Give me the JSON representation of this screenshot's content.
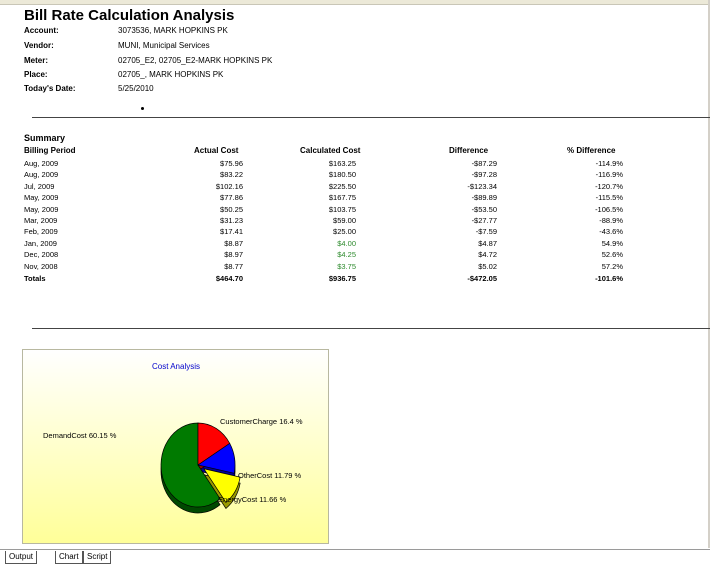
{
  "report": {
    "title": "Bill Rate Calculation Analysis",
    "header": [
      {
        "label": "Account:",
        "value": "3073536, MARK HOPKINS PK"
      },
      {
        "label": "Vendor:",
        "value": "MUNI, Municipal Services"
      },
      {
        "label": "Meter:",
        "value": "02705_E2, 02705_E2-MARK HOPKINS PK"
      },
      {
        "label": "Place:",
        "value": "02705_, MARK HOPKINS PK"
      },
      {
        "label": "Today's Date:",
        "value": "5/25/2010"
      }
    ]
  },
  "summary": {
    "title": "Summary",
    "columns": [
      "Billing Period",
      "Actual Cost",
      "Calculated Cost",
      "Difference",
      "% Difference"
    ],
    "rows": [
      [
        "Aug, 2009",
        "$75.96",
        "$163.25",
        "-$87.29",
        "-114.9%"
      ],
      [
        "Aug, 2009",
        "$83.22",
        "$180.50",
        "-$97.28",
        "-116.9%"
      ],
      [
        "Jul, 2009",
        "$102.16",
        "$225.50",
        "-$123.34",
        "-120.7%"
      ],
      [
        "May, 2009",
        "$77.86",
        "$167.75",
        "-$89.89",
        "-115.5%"
      ],
      [
        "May, 2009",
        "$50.25",
        "$103.75",
        "-$53.50",
        "-106.5%"
      ],
      [
        "Mar, 2009",
        "$31.23",
        "$59.00",
        "-$27.77",
        "-88.9%"
      ],
      [
        "Feb, 2009",
        "$17.41",
        "$25.00",
        "-$7.59",
        "-43.6%"
      ],
      [
        "Jan, 2009",
        "$8.87",
        "$4.00",
        "$4.87",
        "54.9%"
      ],
      [
        "Dec, 2008",
        "$8.97",
        "$4.25",
        "$4.72",
        "52.6%"
      ],
      [
        "Nov, 2008",
        "$8.77",
        "$3.75",
        "$5.02",
        "57.2%"
      ]
    ],
    "green_calculated_rows": [
      7,
      8,
      9
    ],
    "totals": [
      "Totals",
      "$464.70",
      "$936.75",
      "-$472.05",
      "-101.6%"
    ]
  },
  "chart_data": {
    "type": "pie",
    "title": "Cost Analysis",
    "slices": [
      {
        "name": "DemandCost",
        "value": 60.15,
        "label": "DemandCost 60.15 %",
        "color": "#007a00"
      },
      {
        "name": "CustomerCharge",
        "value": 16.4,
        "label": "CustomerCharge 16.4 %",
        "color": "#ff0000"
      },
      {
        "name": "OtherCost",
        "value": 11.79,
        "label": "OtherCost 11.79 %",
        "color": "#0000ff"
      },
      {
        "name": "EnergyCost",
        "value": 11.66,
        "label": "EnergyCost 11.66 %",
        "color": "#ffff00"
      }
    ],
    "exploded": "EnergyCost",
    "style": "3d"
  },
  "tabs": [
    "Output",
    "Chart",
    "Script"
  ],
  "active_tab": "Output"
}
